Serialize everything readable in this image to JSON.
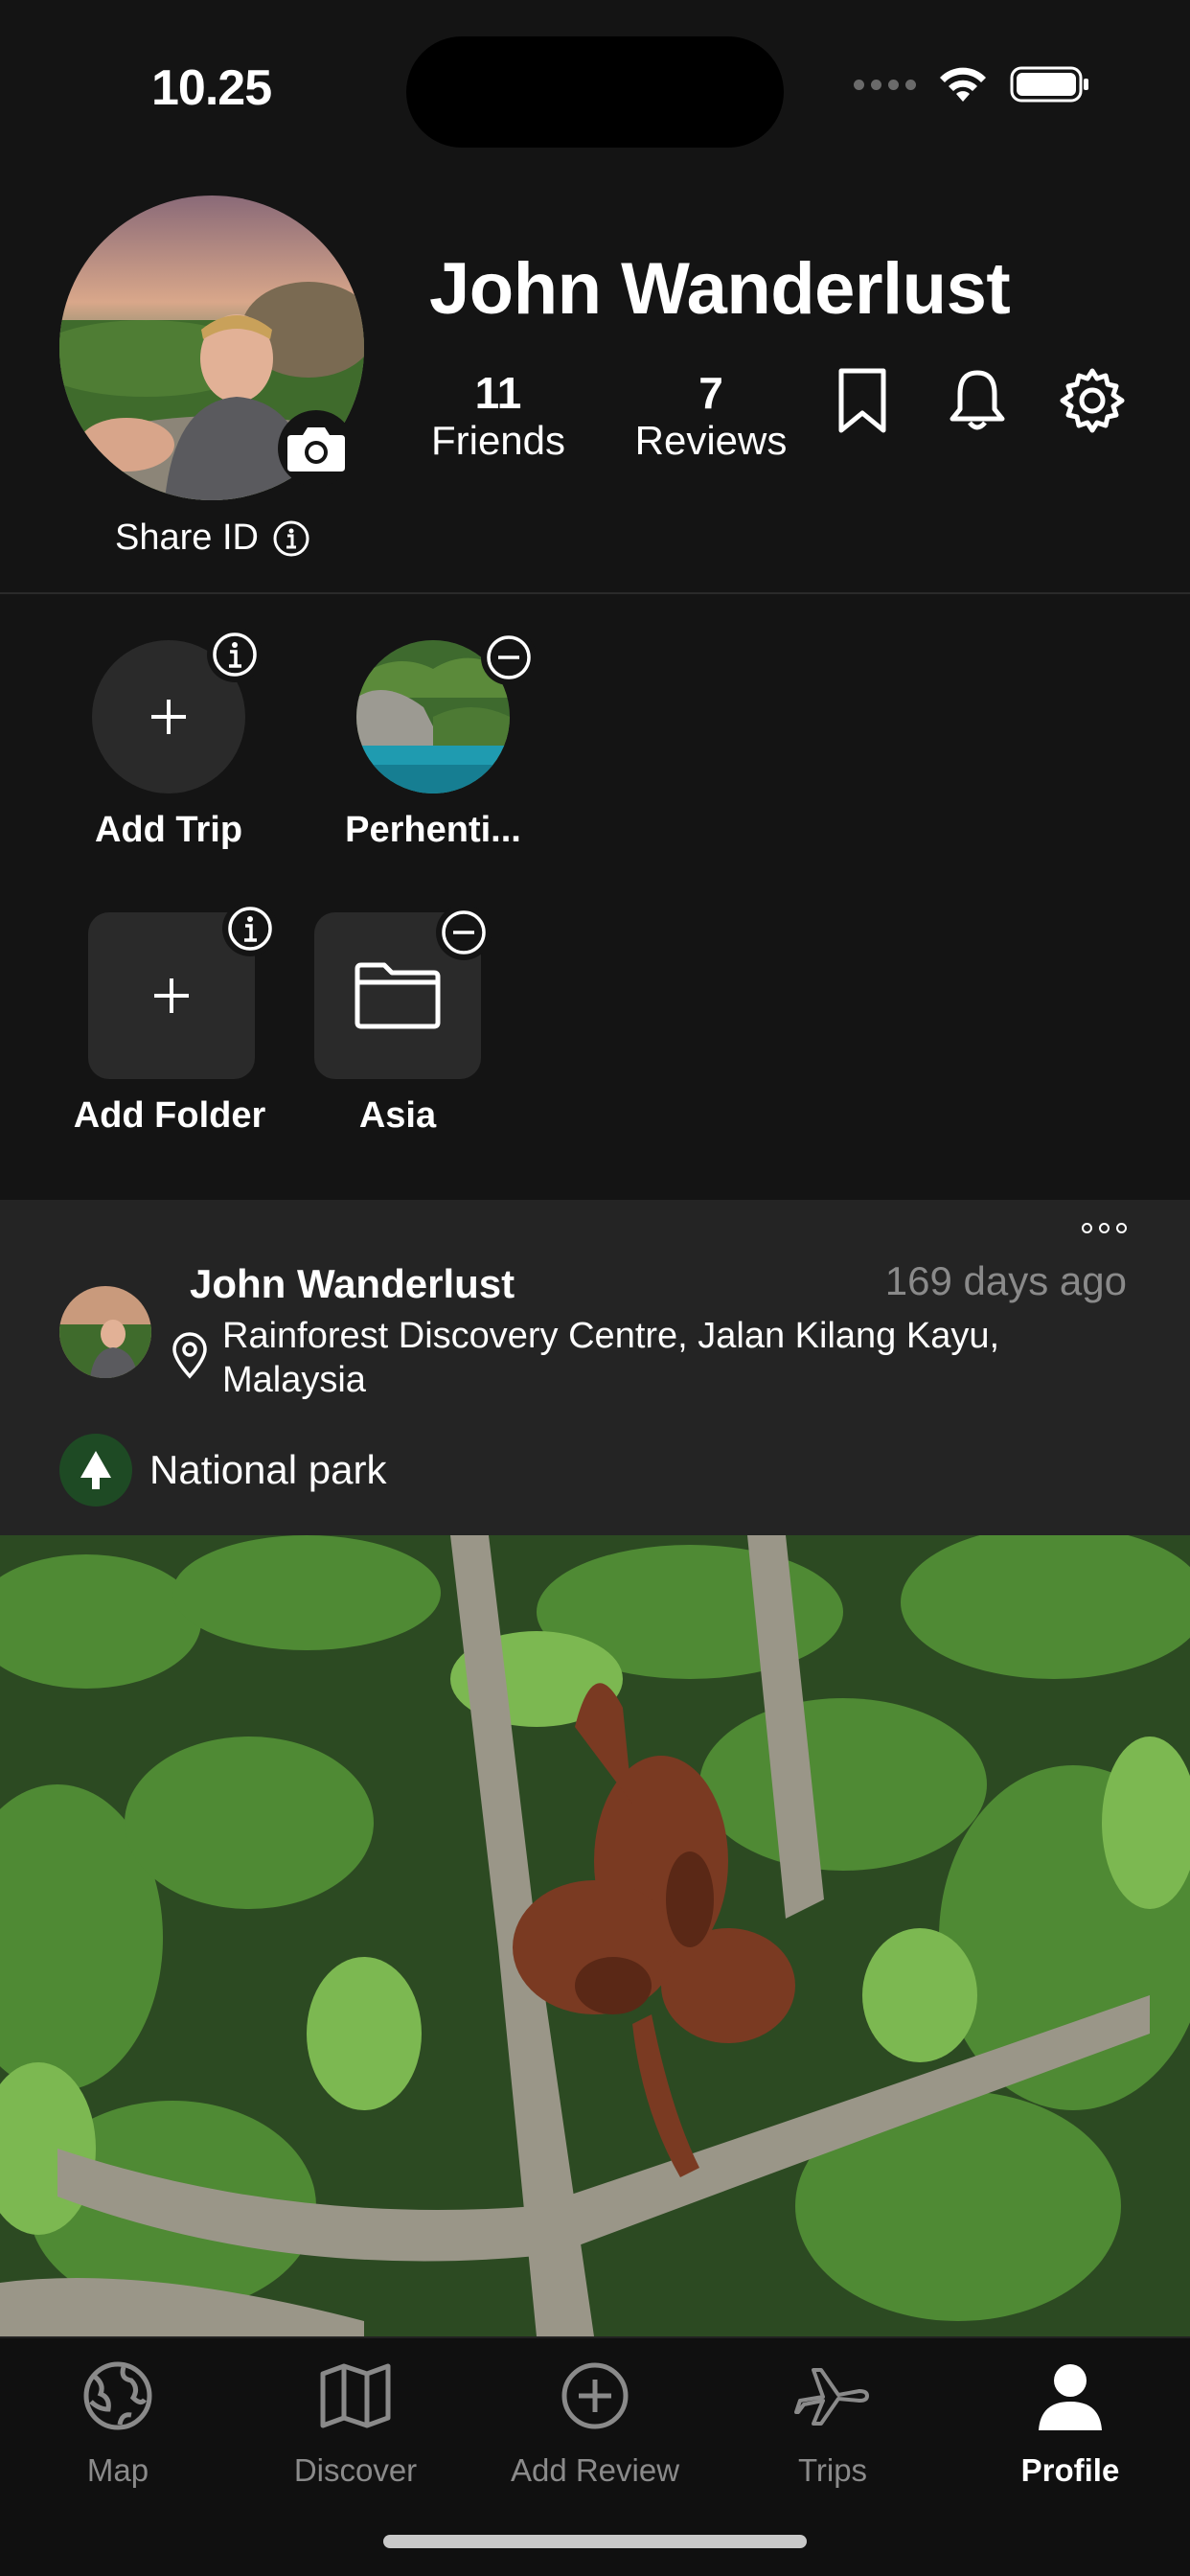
{
  "status_bar": {
    "time": "10.25"
  },
  "profile": {
    "name": "John Wanderlust",
    "share_id_label": "Share ID",
    "stats": [
      {
        "value": "11",
        "label": "Friends"
      },
      {
        "value": "7",
        "label": "Reviews"
      }
    ]
  },
  "collections": {
    "trips": [
      {
        "label": "Add Trip"
      },
      {
        "label": "Perhenti..."
      }
    ],
    "folders": [
      {
        "label": "Add Folder"
      },
      {
        "label": "Asia"
      }
    ]
  },
  "post": {
    "author": "John Wanderlust",
    "time_ago": "169 days ago",
    "location": "Rainforest Discovery Centre, Jalan Kilang Kayu, Malaysia",
    "tag": "National park"
  },
  "tabs": [
    {
      "label": "Map",
      "icon": "globe-icon"
    },
    {
      "label": "Discover",
      "icon": "map-icon"
    },
    {
      "label": "Add Review",
      "icon": "plus-circle-icon"
    },
    {
      "label": "Trips",
      "icon": "airplane-icon"
    },
    {
      "label": "Profile",
      "icon": "person-icon",
      "active": true
    }
  ],
  "colors": {
    "background": "#141414",
    "card": "#242424",
    "accent_green": "#1e4a24",
    "muted": "#8a8a8a"
  }
}
